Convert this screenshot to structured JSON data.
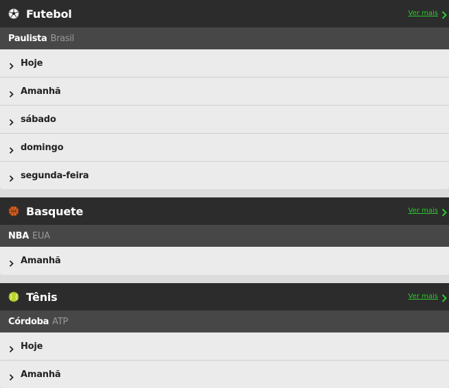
{
  "sections": [
    {
      "sport": "Futebol",
      "icon": "soccer-ball-icon",
      "more_label": "Ver mais",
      "league": "Paulista",
      "country": "Brasil",
      "days": [
        "Hoje",
        "Amanhã",
        "sábado",
        "domingo",
        "segunda-feira"
      ]
    },
    {
      "sport": "Basquete",
      "icon": "basketball-icon",
      "more_label": "Ver mais",
      "league": "NBA",
      "country": "EUA",
      "days": [
        "Amanhã"
      ]
    },
    {
      "sport": "Tênis",
      "icon": "tennis-ball-icon",
      "more_label": "Ver mais",
      "league": "Córdoba",
      "country": "ATP",
      "days": [
        "Hoje",
        "Amanhã"
      ]
    }
  ],
  "colors": {
    "header_bg": "#2c2c2c",
    "league_bg": "#474747",
    "row_bg": "#ebebeb",
    "link_green": "#2ec82e"
  }
}
